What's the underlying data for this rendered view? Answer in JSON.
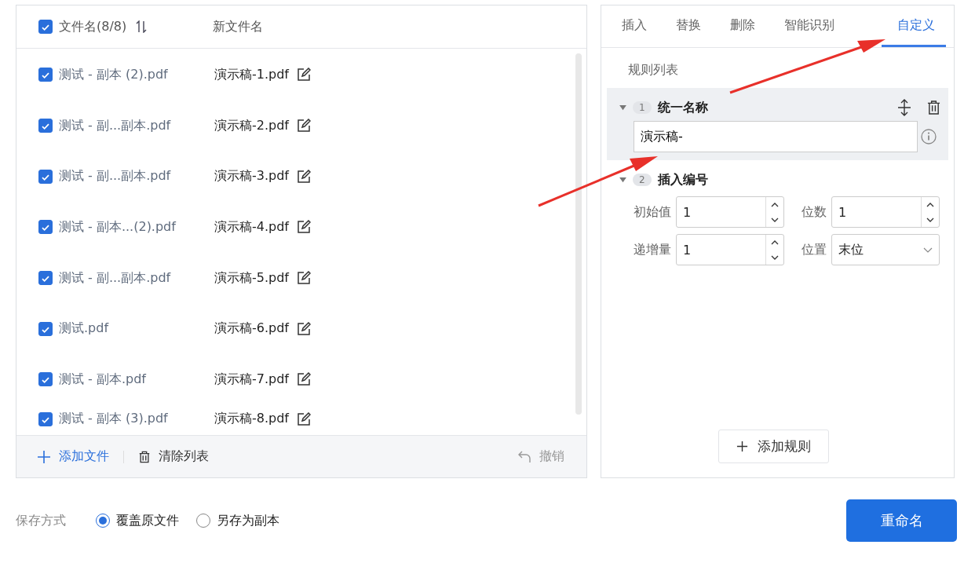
{
  "file_list": {
    "header": {
      "select_all": true,
      "name_column": "文件名(8/8)",
      "new_name_column": "新文件名"
    },
    "files": [
      {
        "name": "测试 - 副本 (2).pdf",
        "new_name": "演示稿-1.pdf",
        "checked": true
      },
      {
        "name": "测试 - 副...副本.pdf",
        "new_name": "演示稿-2.pdf",
        "checked": true
      },
      {
        "name": "测试 - 副...副本.pdf",
        "new_name": "演示稿-3.pdf",
        "checked": true
      },
      {
        "name": "测试 - 副本...(2).pdf",
        "new_name": "演示稿-4.pdf",
        "checked": true
      },
      {
        "name": "测试 - 副...副本.pdf",
        "new_name": "演示稿-5.pdf",
        "checked": true
      },
      {
        "name": "测试.pdf",
        "new_name": "演示稿-6.pdf",
        "checked": true
      },
      {
        "name": "测试 - 副本.pdf",
        "new_name": "演示稿-7.pdf",
        "checked": true
      },
      {
        "name": "测试 - 副本 (3).pdf",
        "new_name": "演示稿-8.pdf",
        "checked": true
      }
    ],
    "footer": {
      "add": "添加文件",
      "clear": "清除列表",
      "undo": "撤销"
    }
  },
  "rules_panel": {
    "tabs": [
      {
        "label": "插入",
        "selected": false
      },
      {
        "label": "替换",
        "selected": false
      },
      {
        "label": "删除",
        "selected": false
      },
      {
        "label": "智能识别",
        "selected": false
      },
      {
        "label": "自定义",
        "selected": true
      }
    ],
    "section_title": "规则列表",
    "rules": [
      {
        "index": "1",
        "title": "统一名称",
        "selected": true,
        "kind": "text",
        "value": "演示稿-"
      },
      {
        "index": "2",
        "title": "插入编号",
        "selected": false,
        "kind": "numbering",
        "fields": [
          {
            "label": "初始值",
            "kind": "spinner",
            "value": "1"
          },
          {
            "label": "位数",
            "kind": "spinner",
            "value": "1"
          },
          {
            "label": "递增量",
            "kind": "spinner",
            "value": "1"
          },
          {
            "label": "位置",
            "kind": "select",
            "value": "末位"
          }
        ]
      }
    ],
    "add_rule": "添加规则"
  },
  "save_mode": {
    "label": "保存方式",
    "options": [
      {
        "label": "覆盖原文件",
        "selected": true
      },
      {
        "label": "另存为副本",
        "selected": false
      }
    ]
  },
  "rename_button": "重命名"
}
